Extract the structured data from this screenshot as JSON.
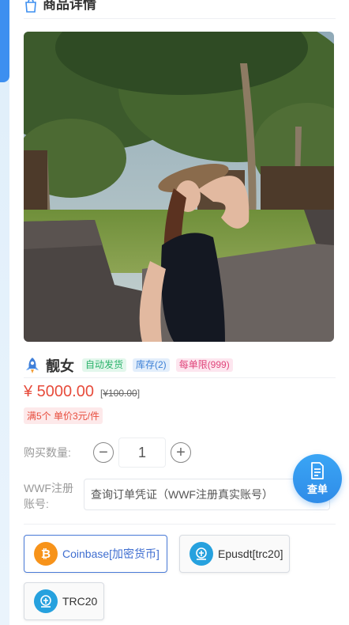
{
  "header": {
    "title": "商品详情",
    "icon": "bag-icon"
  },
  "product": {
    "name": "靓女",
    "tags": [
      "自动发货",
      "库存(2)",
      "每单限(999)"
    ],
    "price": "¥ 5000.00",
    "old_price_prefix": "[",
    "old_price": "¥100.00",
    "old_price_suffix": "]",
    "discount": "满5个 单价3元/件",
    "photo_icon": "product-photo"
  },
  "quantity": {
    "label": "购买数量:",
    "value": "1",
    "minus": "−",
    "plus": "+"
  },
  "account": {
    "label": "WWF注册账号:",
    "placeholder": "查询订单凭证（WWF注册真实账号）"
  },
  "fab": {
    "label": "查单",
    "icon": "document-icon"
  },
  "payments": [
    {
      "label": "Coinbase[加密货币]",
      "icon": "bitcoin-icon",
      "color": "#f7931a",
      "selected": true
    },
    {
      "label": "Epusdt[trc20]",
      "icon": "usdt-icon",
      "color": "#26a1de",
      "selected": false
    },
    {
      "label": "TRC20",
      "icon": "usdt-icon",
      "color": "#26a1de",
      "selected": false
    }
  ],
  "colors": {
    "accent": "#3d8ff0",
    "price": "#e74c3c"
  }
}
